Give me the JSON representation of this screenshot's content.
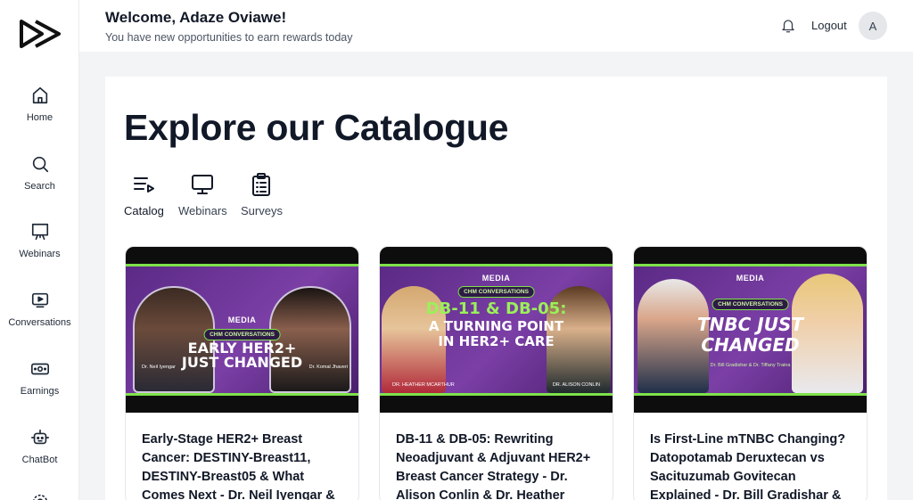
{
  "header": {
    "welcome": "Welcome, Adaze Oviawe!",
    "subtitle": "You have new opportunities to earn rewards today",
    "logout": "Logout",
    "avatar_initial": "A"
  },
  "sidebar": {
    "items": [
      {
        "label": "Home",
        "icon": "home-icon"
      },
      {
        "label": "Search",
        "icon": "search-icon"
      },
      {
        "label": "Webinars",
        "icon": "presentation-icon"
      },
      {
        "label": "Conversations",
        "icon": "video-play-icon"
      },
      {
        "label": "Earnings",
        "icon": "money-icon"
      },
      {
        "label": "ChatBot",
        "icon": "bot-icon"
      }
    ]
  },
  "main": {
    "title": "Explore our Catalogue",
    "tabs": [
      {
        "label": "Catalog",
        "icon": "list-play-icon",
        "active": true
      },
      {
        "label": "Webinars",
        "icon": "monitor-icon",
        "active": false
      },
      {
        "label": "Surveys",
        "icon": "clipboard-icon",
        "active": false
      }
    ],
    "cards": [
      {
        "title": "Early-Stage HER2+ Breast Cancer: DESTINY-Breast11, DESTINY-Breast05 & What Comes Next - Dr. Neil Iyengar &",
        "thumb": {
          "brand": "MEDIA",
          "pill": "CHM CONVERSATIONS",
          "headline_1": "EARLY HER2+",
          "headline_2": "JUST CHANGED",
          "caption_left": "Dr. Neil Iyengar",
          "caption_right": "Dr. Komal Jhaveri"
        }
      },
      {
        "title": "DB-11 & DB-05: Rewriting Neoadjuvant & Adjuvant HER2+ Breast Cancer Strategy - Dr. Alison Conlin & Dr. Heather",
        "thumb": {
          "brand": "MEDIA",
          "pill": "CHM CONVERSATIONS",
          "headline_1": "DB-11 & DB-05:",
          "headline_2": "A TURNING POINT",
          "headline_3": "IN HER2+ CARE",
          "caption_left": "DR. HEATHER MCARTHUR",
          "caption_right": "DR. ALISON CONLIN"
        }
      },
      {
        "title": "Is First-Line mTNBC Changing? Datopotamab Deruxtecan vs Sacituzumab Govitecan Explained - Dr. Bill Gradishar &",
        "thumb": {
          "brand": "MEDIA",
          "pill": "CHM CONVERSATIONS",
          "headline_1": "TNBC JUST",
          "headline_2": "CHANGED",
          "caption_center": "Dr. Bill Gradishar & Dr. Tiffany Traina"
        }
      }
    ]
  },
  "colors": {
    "accent_green": "#7ee24a",
    "thumb_purple": "#6b3396",
    "text_dark": "#111827"
  }
}
